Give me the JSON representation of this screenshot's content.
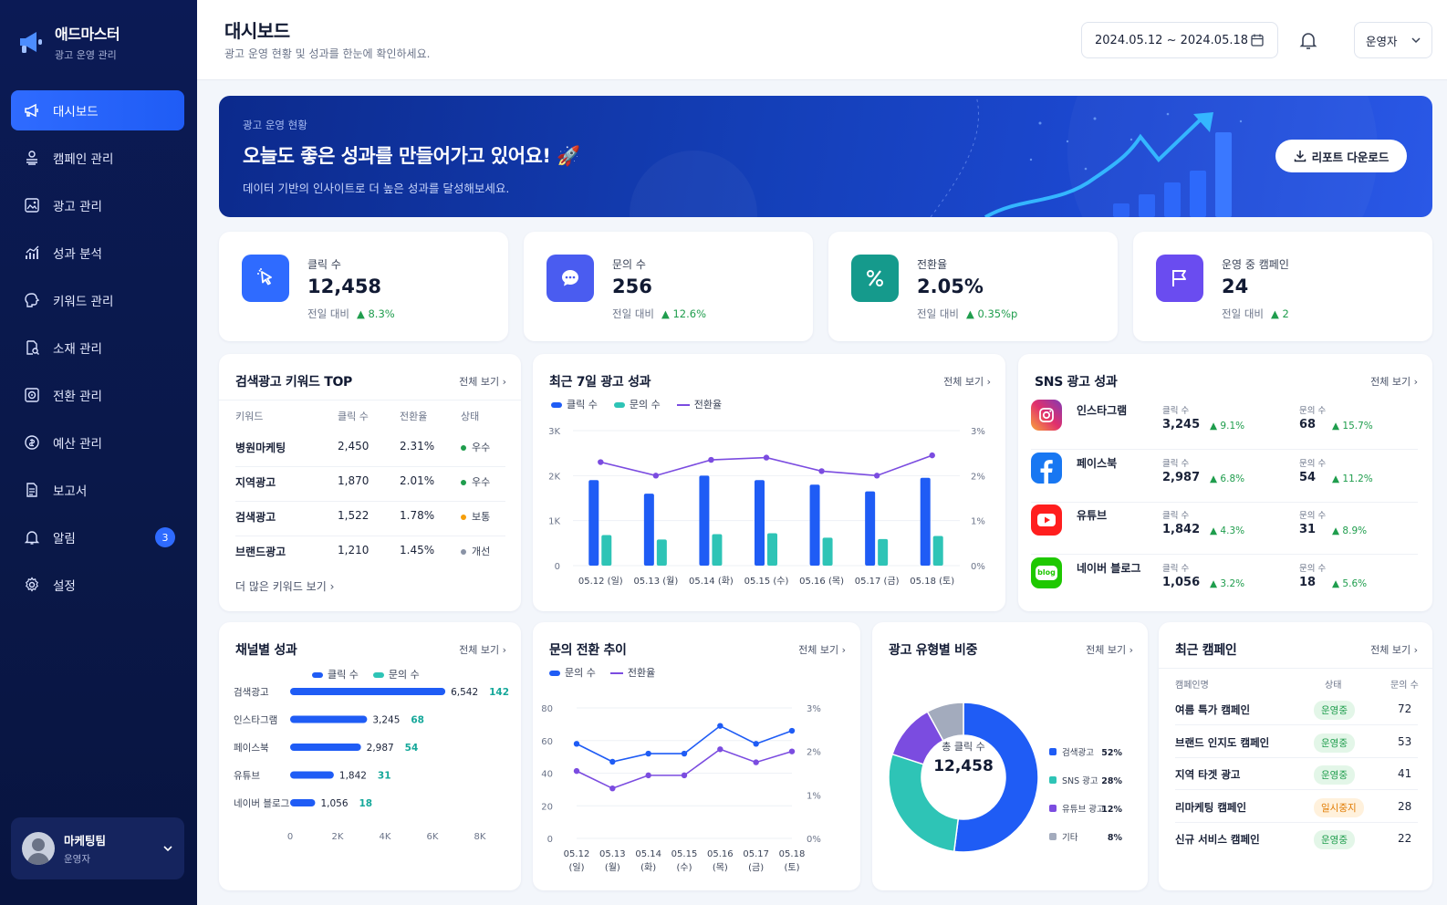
{
  "app": {
    "name": "애드마스터",
    "subtitle": "광고 운영 관리"
  },
  "nav": [
    {
      "label": "대시보드",
      "icon": "megaphone-icon",
      "active": true
    },
    {
      "label": "캠페인 관리",
      "icon": "layers-icon"
    },
    {
      "label": "광고 관리",
      "icon": "image-icon"
    },
    {
      "label": "성과 분석",
      "icon": "bar-chart-icon"
    },
    {
      "label": "키워드 관리",
      "icon": "brain-icon"
    },
    {
      "label": "소재 관리",
      "icon": "file-search-icon"
    },
    {
      "label": "전환 관리",
      "icon": "target-icon"
    },
    {
      "label": "예산 관리",
      "icon": "coin-icon"
    },
    {
      "label": "보고서",
      "icon": "document-icon"
    },
    {
      "label": "알림",
      "icon": "bell-icon",
      "badge": "3"
    },
    {
      "label": "설정",
      "icon": "gear-icon"
    }
  ],
  "user": {
    "name": "마케팅팀",
    "role": "운영자"
  },
  "header": {
    "title": "대시보드",
    "subtitle": "광고 운영 현황 및 성과를 한눈에 확인하세요.",
    "date_range": "2024.05.12 ~ 2024.05.18",
    "role_select": "운영자"
  },
  "hero": {
    "label": "광고 운영 현황",
    "title": "오늘도 좋은 성과를 만들어가고 있어요! 🚀",
    "subtitle": "데이터 기반의 인사이트로 더 높은 성과를 달성해보세요.",
    "button": "리포트 다운로드"
  },
  "kpis": [
    {
      "label": "클릭 수",
      "value": "12,458",
      "compare": "전일 대비",
      "delta": "8.3%",
      "color": "#2f6bff",
      "icon": "cursor-click-icon"
    },
    {
      "label": "문의 수",
      "value": "256",
      "compare": "전일 대비",
      "delta": "12.6%",
      "color": "#4a5cf0",
      "icon": "chat-icon"
    },
    {
      "label": "전환율",
      "value": "2.05%",
      "compare": "전일 대비",
      "delta": "0.35%p",
      "color": "#159a8c",
      "icon": "percent-icon"
    },
    {
      "label": "운영 중 캠페인",
      "value": "24",
      "compare": "전일 대비",
      "delta": "2",
      "color": "#6a4cf0",
      "icon": "flag-icon"
    }
  ],
  "keywords": {
    "title": "검색광고 키워드 TOP",
    "more": "전체 보기",
    "headers": [
      "키워드",
      "클릭 수",
      "전환율",
      "상태"
    ],
    "rows": [
      {
        "keyword": "병원마케팅",
        "clicks": "2,450",
        "rate": "2.31%",
        "status": "우수",
        "color": "#1f9d4d"
      },
      {
        "keyword": "지역광고",
        "clicks": "1,870",
        "rate": "2.01%",
        "status": "우수",
        "color": "#1f9d4d"
      },
      {
        "keyword": "검색광고",
        "clicks": "1,522",
        "rate": "1.78%",
        "status": "보통",
        "color": "#f59e0b"
      },
      {
        "keyword": "브랜드광고",
        "clicks": "1,210",
        "rate": "1.45%",
        "status": "개선",
        "color": "#8a93a6"
      }
    ],
    "footer": "더 많은 키워드 보기"
  },
  "weekly": {
    "title": "최근 7일 광고 성과",
    "more": "전체 보기",
    "legend": [
      "클릭 수",
      "문의 수",
      "전환율"
    ]
  },
  "sns": {
    "title": "SNS 광고 성과",
    "more": "전체 보기",
    "click_label": "클릭 수",
    "inquiry_label": "문의 수",
    "rows": [
      {
        "name": "인스타그램",
        "icon": "instagram-icon",
        "clicks": "3,245",
        "clicks_delta": "9.1%",
        "inquiries": "68",
        "inq_delta": "15.7%"
      },
      {
        "name": "페이스북",
        "icon": "facebook-icon",
        "clicks": "2,987",
        "clicks_delta": "6.8%",
        "inquiries": "54",
        "inq_delta": "11.2%"
      },
      {
        "name": "유튜브",
        "icon": "youtube-icon",
        "clicks": "1,842",
        "clicks_delta": "4.3%",
        "inquiries": "31",
        "inq_delta": "8.9%"
      },
      {
        "name": "네이버 블로그",
        "icon": "naver-blog-icon",
        "clicks": "1,056",
        "clicks_delta": "3.2%",
        "inquiries": "18",
        "inq_delta": "5.6%"
      }
    ]
  },
  "channel": {
    "title": "채널별 성과",
    "more": "전체 보기",
    "legend": [
      "클릭 수",
      "문의 수"
    ]
  },
  "inquiry_trend": {
    "title": "문의 전환 추이",
    "more": "전체 보기",
    "legend": [
      "문의 수",
      "전환율"
    ]
  },
  "ad_type": {
    "title": "광고 유형별 비중",
    "more": "전체 보기",
    "center_label": "총 클릭 수",
    "center_value": "12,458"
  },
  "campaigns": {
    "title": "최근 캠페인",
    "more": "전체 보기",
    "headers": [
      "캠페인명",
      "상태",
      "문의 수"
    ],
    "rows": [
      {
        "name": "여름 특가 캠페인",
        "status": "운영중",
        "count": "72",
        "paused": false
      },
      {
        "name": "브랜드 인지도 캠페인",
        "status": "운영중",
        "count": "53",
        "paused": false
      },
      {
        "name": "지역 타겟 광고",
        "status": "운영중",
        "count": "41",
        "paused": false
      },
      {
        "name": "리마케팅 캠페인",
        "status": "일시중지",
        "count": "28",
        "paused": true
      },
      {
        "name": "신규 서비스 캠페인",
        "status": "운영중",
        "count": "22",
        "paused": false
      }
    ]
  },
  "chart_data": [
    {
      "type": "bar",
      "title": "최근 7일 광고 성과",
      "categories": [
        "05.12 (일)",
        "05.13 (월)",
        "05.14 (화)",
        "05.15 (수)",
        "05.16 (목)",
        "05.17 (금)",
        "05.18 (토)"
      ],
      "series": [
        {
          "name": "클릭 수",
          "type": "bar",
          "axis": "left",
          "color": "#1f5cf5",
          "values": [
            1900,
            1600,
            2000,
            1900,
            1800,
            1650,
            1950
          ]
        },
        {
          "name": "문의 수",
          "type": "bar",
          "axis": "left",
          "color": "#2ec4b6",
          "values": [
            680,
            580,
            700,
            720,
            620,
            590,
            660
          ]
        },
        {
          "name": "전환율",
          "type": "line",
          "axis": "right",
          "color": "#7b4ce0",
          "values": [
            2.3,
            2.0,
            2.35,
            2.4,
            2.1,
            2.0,
            2.45
          ]
        }
      ],
      "y_ticks": [
        "0",
        "1K",
        "2K",
        "3K"
      ],
      "ylim": [
        0,
        3000
      ],
      "y2_ticks": [
        "0%",
        "1%",
        "2%",
        "3%"
      ],
      "y2lim": [
        0,
        3
      ]
    },
    {
      "type": "bar",
      "orientation": "horizontal",
      "title": "채널별 성과",
      "categories": [
        "검색광고",
        "인스타그램",
        "페이스북",
        "유튜브",
        "네이버 블로그"
      ],
      "series": [
        {
          "name": "클릭 수",
          "color": "#1f5cf5",
          "values": [
            6542,
            3245,
            2987,
            1842,
            1056
          ],
          "labels": [
            "6,542",
            "3,245",
            "2,987",
            "1,842",
            "1,056"
          ]
        },
        {
          "name": "문의 수",
          "color": "#2ec4b6",
          "values": [
            142,
            68,
            54,
            31,
            18
          ]
        }
      ],
      "x_ticks": [
        "0",
        "2K",
        "4K",
        "6K",
        "8K"
      ],
      "xlim": [
        0,
        8000
      ]
    },
    {
      "type": "line",
      "title": "문의 전환 추이",
      "categories": [
        [
          "05.12",
          "(일)"
        ],
        [
          "05.13",
          "(월)"
        ],
        [
          "05.14",
          "(화)"
        ],
        [
          "05.15",
          "(수)"
        ],
        [
          "05.16",
          "(목)"
        ],
        [
          "05.17",
          "(금)"
        ],
        [
          "05.18",
          "(토)"
        ]
      ],
      "series": [
        {
          "name": "문의 수",
          "axis": "left",
          "color": "#1f5cf5",
          "values": [
            58,
            47,
            52,
            52,
            69,
            58,
            66
          ]
        },
        {
          "name": "전환율",
          "axis": "right",
          "color": "#7b4ce0",
          "values": [
            1.55,
            1.15,
            1.45,
            1.45,
            2.05,
            1.75,
            2.0
          ]
        }
      ],
      "y_ticks": [
        "0",
        "20",
        "40",
        "60",
        "80"
      ],
      "ylim": [
        0,
        80
      ],
      "y2_ticks": [
        "0%",
        "1%",
        "2%",
        "3%"
      ],
      "y2lim": [
        0,
        3
      ]
    },
    {
      "type": "pie",
      "title": "광고 유형별 비중",
      "slices": [
        {
          "label": "검색광고",
          "value": 52,
          "display": "52%",
          "color": "#1f5cf5"
        },
        {
          "label": "SNS 광고",
          "value": 28,
          "display": "28%",
          "color": "#2ec4b6"
        },
        {
          "label": "유튜브 광고",
          "value": 12,
          "display": "12%",
          "color": "#7b4ce0"
        },
        {
          "label": "기타",
          "value": 8,
          "display": "8%",
          "color": "#a3abbd"
        }
      ]
    }
  ]
}
